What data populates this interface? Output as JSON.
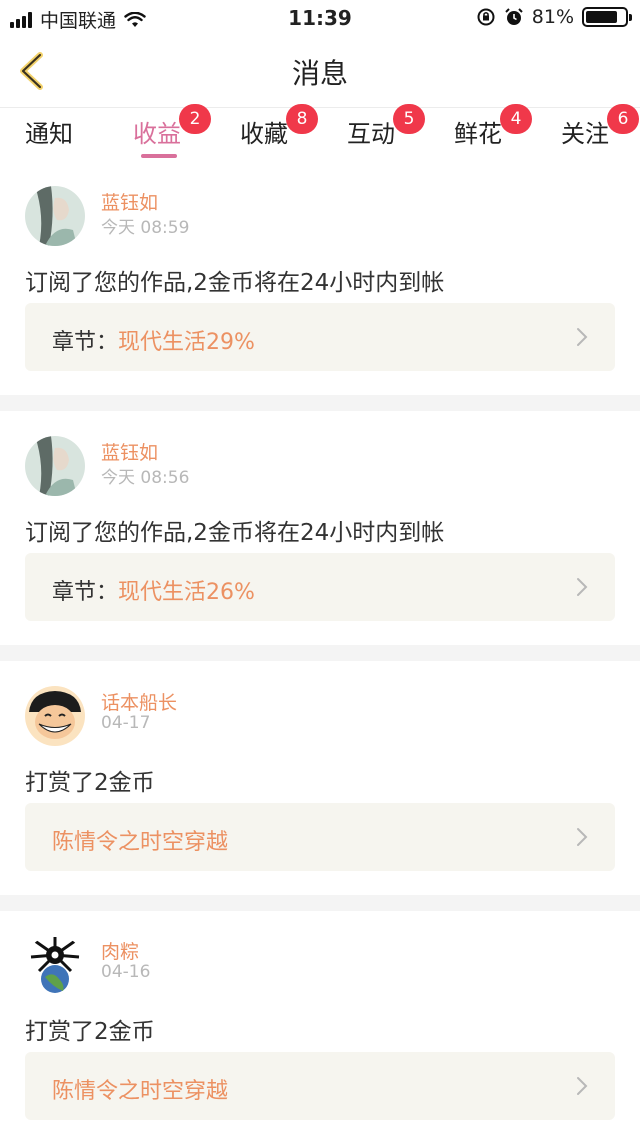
{
  "status_bar": {
    "carrier": "中国联通",
    "time": "11:39",
    "battery_text": "81%",
    "battery_level": 0.81
  },
  "nav": {
    "back_icon": "chevron-left-icon",
    "title": "消息"
  },
  "tabs": [
    {
      "label": "通知",
      "badge": "",
      "active": false
    },
    {
      "label": "收益",
      "badge": "2",
      "active": true
    },
    {
      "label": "收藏",
      "badge": "8",
      "active": false
    },
    {
      "label": "互动",
      "badge": "5",
      "active": false
    },
    {
      "label": "鲜花",
      "badge": "4",
      "active": false
    },
    {
      "label": "关注",
      "badge": "6",
      "active": false
    }
  ],
  "messages": [
    {
      "user": "蓝钰如",
      "time": "今天 08:59",
      "text": "订阅了您的作品,2金币将在24小时内到帐",
      "card_label": "章节：",
      "card_value": "现代生活29%"
    },
    {
      "user": "蓝钰如",
      "time": "今天 08:56",
      "text": "订阅了您的作品,2金币将在24小时内到帐",
      "card_label": "章节：",
      "card_value": "现代生活26%"
    },
    {
      "user": "话本船长",
      "time": "04-17",
      "text": "打赏了2金币",
      "card_label": "",
      "card_value": "陈情令之时空穿越"
    },
    {
      "user": "肉粽",
      "time": "04-16",
      "text": "打赏了2金币",
      "card_label": "",
      "card_value": "陈情令之时空穿越"
    }
  ],
  "colors": {
    "accent": "#d9709b",
    "badge": "#f0384a",
    "username": "#ec9162",
    "card_bg": "#f6f5ef"
  }
}
